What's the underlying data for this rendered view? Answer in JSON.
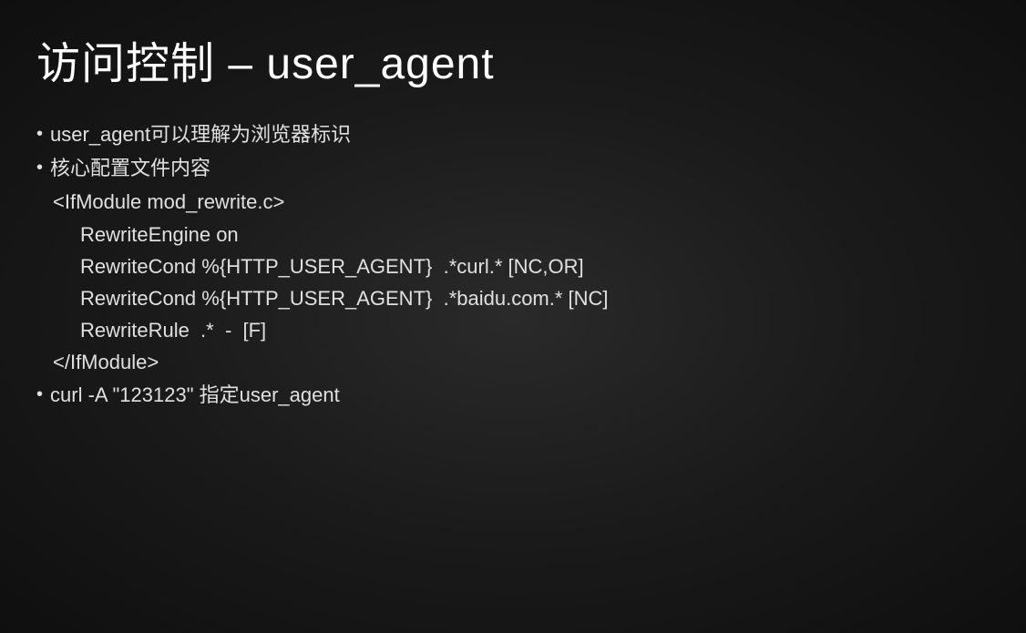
{
  "title": "访问控制 – user_agent",
  "bullets": {
    "item1": "user_agent可以理解为浏览器标识",
    "item2": "核心配置文件内容",
    "item3": "curl -A \"123123\" 指定user_agent"
  },
  "code": {
    "line1": "<IfModule mod_rewrite.c>",
    "line2": "RewriteEngine on",
    "line3": "RewriteCond %{HTTP_USER_AGENT}  .*curl.* [NC,OR]",
    "line4": "RewriteCond %{HTTP_USER_AGENT}  .*baidu.com.* [NC]",
    "line5": "RewriteRule  .*  -  [F]",
    "line6": "</IfModule>"
  },
  "bullet_char": "•"
}
